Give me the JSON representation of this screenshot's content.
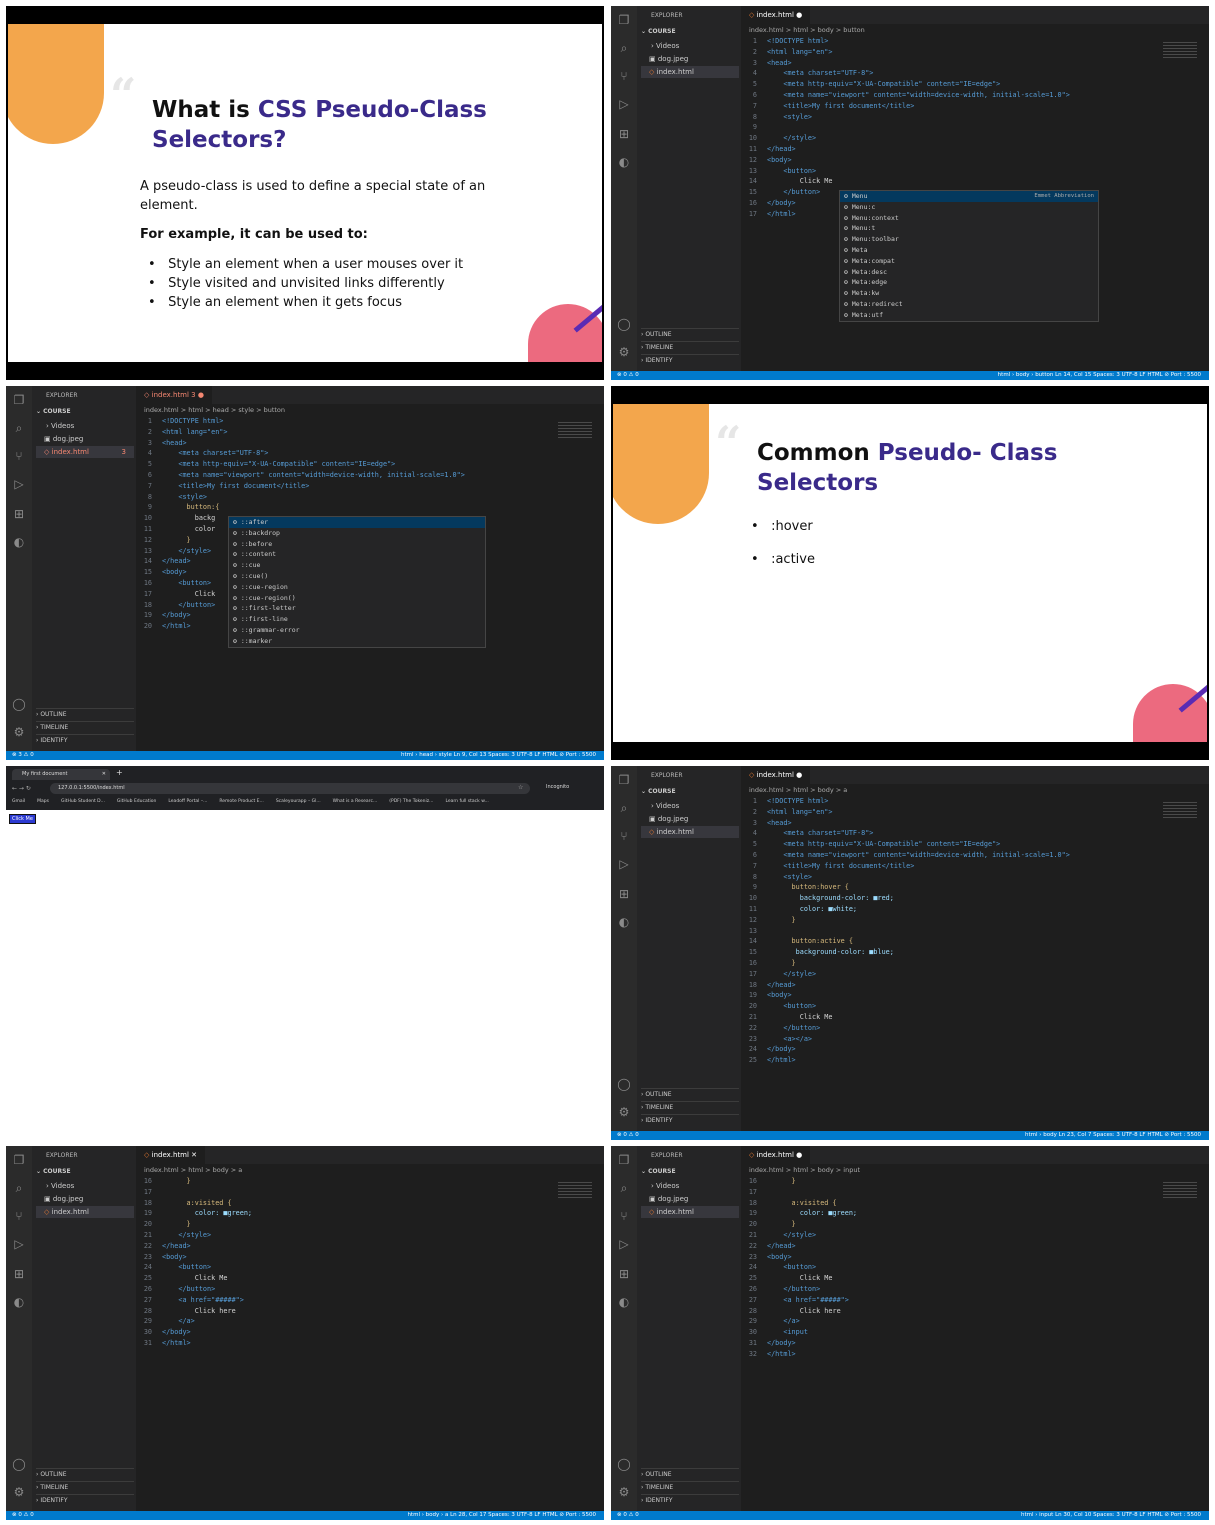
{
  "slide1": {
    "title_a": "What is ",
    "title_b": "CSS Pseudo-Class",
    "title_c": "Selectors?",
    "intro": "A pseudo-class is used to define a special state of an element.",
    "example": "For example, it can be used to:",
    "bullets": [
      "Style an element when a user mouses over it",
      "Style visited and unvisited links differently",
      "Style an element when it gets focus"
    ]
  },
  "slide2": {
    "title_a": "Common ",
    "title_b": "Pseudo- Class",
    "title_c": "Selectors",
    "bullets": [
      ":hover",
      ":active"
    ]
  },
  "explorer": {
    "title": "EXPLORER",
    "folder": "COURSE",
    "items": [
      "Videos",
      "dog.jpeg",
      "index.html"
    ],
    "outline": "OUTLINE",
    "timeline": "TIMELINE",
    "identify": "IDENTIFY"
  },
  "vs1": {
    "tab": "index.html",
    "crumb": "index.html > html > body > button",
    "lines": [
      "<!DOCTYPE html>",
      "<html lang=\"en\">",
      "<head>",
      "    <meta charset=\"UTF-8\">",
      "    <meta http-equiv=\"X-UA-Compatible\" content=\"IE=edge\">",
      "    <meta name=\"viewport\" content=\"width=device-width, initial-scale=1.0\">",
      "    <title>My first document</title>",
      "    <style>",
      "",
      "    </style>",
      "</head>",
      "<body>",
      "    <button>",
      "        Click Me",
      "    </button>",
      "</body>",
      "</html>"
    ],
    "autocomplete": [
      "Menu",
      "Menu:c",
      "Menu:context",
      "Menu:t",
      "Menu:toolbar",
      "Meta",
      "Meta:compat",
      "Meta:desc",
      "Meta:edge",
      "Meta:kw",
      "Meta:redirect",
      "Meta:utf"
    ],
    "ac_hint": "Emmet Abbreviation",
    "status_left": "⊗ 0 ⚠ 0",
    "status_right": "html › body › button    Ln 14, Col 15    Spaces: 3    UTF-8    LF    HTML    ⊘ Port : 5500"
  },
  "vs2": {
    "tab": "index.html 3",
    "crumb": "index.html > html > head > style > button",
    "lines": [
      "<!DOCTYPE html>",
      "<html lang=\"en\">",
      "<head>",
      "    <meta charset=\"UTF-8\">",
      "    <meta http-equiv=\"X-UA-Compatible\" content=\"IE=edge\">",
      "    <meta name=\"viewport\" content=\"width=device-width, initial-scale=1.0\">",
      "    <title>My first document</title>",
      "    <style>",
      "      button:{",
      "        backg",
      "        color",
      "      }",
      "    </style>",
      "</head>",
      "<body>",
      "    <button>",
      "        Click",
      "    </button>",
      "</body>",
      "</html>"
    ],
    "autocomplete": [
      "::after",
      "::backdrop",
      "::before",
      "::content",
      "::cue",
      "::cue()",
      "::cue-region",
      "::cue-region()",
      "::first-letter",
      "::first-line",
      "::grammar-error",
      "::marker"
    ],
    "status_left": "⊗ 3 ⚠ 0",
    "status_right": "html › head › style    Ln 9, Col 13    Spaces: 3    UTF-8    LF    HTML    ⊘ Port : 5500"
  },
  "browser": {
    "tab": "My first document",
    "url": "127.0.0.1:5500/index.html",
    "bookmarks": [
      "Gmail",
      "Maps",
      "GitHub Student D...",
      "GitHub Education",
      "Leadoff Portal –...",
      "Remote Product E...",
      "Scaleyourapp – Gl...",
      "What is a Researc...",
      "(PDF) The Tokeniz...",
      "Learn full stack w..."
    ],
    "button": "Click Me",
    "incognito": "Incognito"
  },
  "vs3": {
    "tab": "index.html",
    "crumb": "index.html > html > body > a",
    "lines": [
      "<!DOCTYPE html>",
      "<html lang=\"en\">",
      "<head>",
      "    <meta charset=\"UTF-8\">",
      "    <meta http-equiv=\"X-UA-Compatible\" content=\"IE=edge\">",
      "    <meta name=\"viewport\" content=\"width=device-width, initial-scale=1.0\">",
      "    <title>My first document</title>",
      "    <style>",
      "      button:hover {",
      "        background-color: ■red;",
      "        color: ■white;",
      "      }",
      "",
      "      button:active {",
      "       background-color: ■blue;",
      "      }",
      "    </style>",
      "</head>",
      "<body>",
      "    <button>",
      "        Click Me",
      "    </button>",
      "    <a></a>",
      "</body>",
      "</html>"
    ],
    "status_left": "⊗ 0 ⚠ 0",
    "status_right": "html › body    Ln 23, Col 7    Spaces: 3    UTF-8    LF    HTML    ⊘ Port : 5500"
  },
  "vs4": {
    "tab": "index.html",
    "crumb": "index.html > html > body > a",
    "start": 16,
    "lines": [
      "      }",
      "",
      "      a:visited {",
      "        color: ■green;",
      "      }",
      "    </style>",
      "</head>",
      "<body>",
      "    <button>",
      "        Click Me",
      "    </button>",
      "    <a href=\"#####\">",
      "        Click here",
      "    </a>",
      "</body>",
      "</html>"
    ],
    "status_left": "⊗ 0 ⚠ 0",
    "status_right": "html › body › a    Ln 28, Col 17    Spaces: 3    UTF-8    LF    HTML    ⊘ Port : 5500"
  },
  "vs5": {
    "tab": "index.html",
    "crumb": "index.html > html > body > input",
    "start": 16,
    "lines": [
      "      }",
      "",
      "      a:visited {",
      "        color: ■green;",
      "      }",
      "    </style>",
      "</head>",
      "<body>",
      "    <button>",
      "        Click Me",
      "    </button>",
      "    <a href=\"#####\">",
      "        Click here",
      "    </a>",
      "    <input",
      "</body>",
      "</html>"
    ],
    "status_left": "⊗ 0 ⚠ 0",
    "status_right": "html › input    Ln 30, Col 10    Spaces: 3    UTF-8    LF    HTML    ⊘ Port : 5500"
  }
}
